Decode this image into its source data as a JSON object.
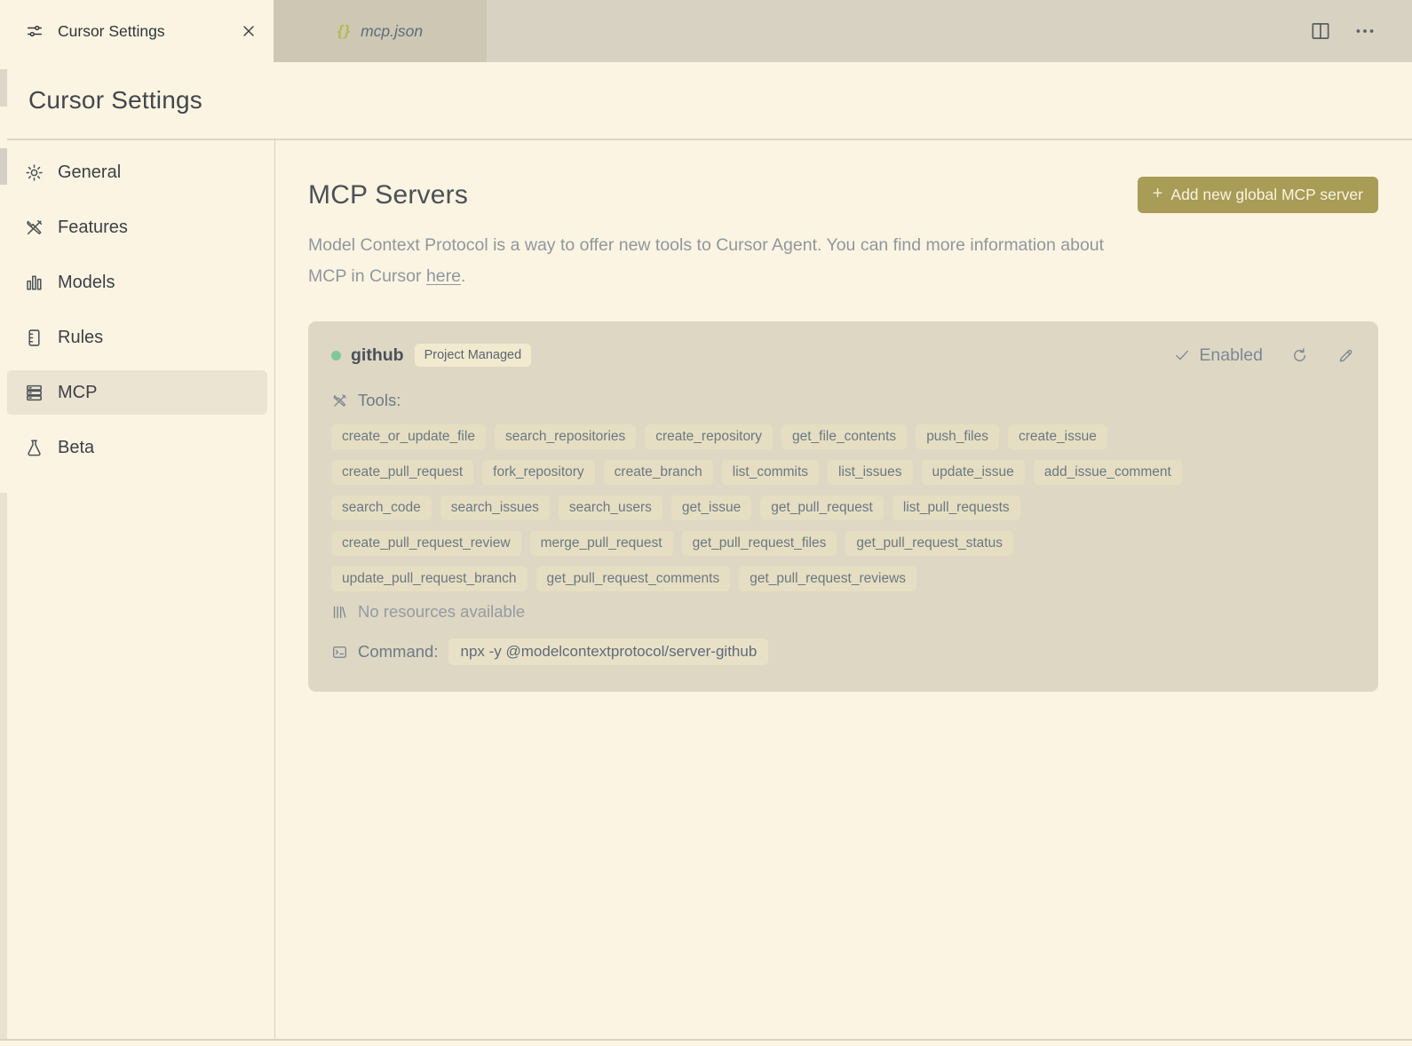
{
  "colors": {
    "page_bg": "#fbf4e2",
    "tab_strip": "#d8d2c2",
    "inactive_tab": "#cec7b4",
    "divider": "#dcd6c6",
    "selected_bg": "#ebe4d3",
    "card_bg": "#ded7c3",
    "tag_bg": "#e6dec2",
    "badge_bg": "#f1eacf",
    "chip_bg": "#e8e1c8",
    "accent": "#a89c56",
    "button_text": "#faf4e1",
    "text_grey": "#90979e",
    "status": "#7b8994",
    "dot": "#80c79a"
  },
  "window": {
    "tabs": [
      {
        "label": "Cursor Settings",
        "icon": "sliders",
        "active": true
      },
      {
        "label": "mcp.json",
        "icon": "braces",
        "icon_glyph": "{}",
        "active": false
      }
    ],
    "actions": [
      {
        "icon": "split-editor"
      },
      {
        "icon": "more"
      }
    ]
  },
  "header": {
    "title": "Cursor Settings"
  },
  "sidebar": {
    "items": [
      {
        "label": "General",
        "icon": "gear"
      },
      {
        "label": "Features",
        "icon": "tools"
      },
      {
        "label": "Models",
        "icon": "bar-chart"
      },
      {
        "label": "Rules",
        "icon": "rules"
      },
      {
        "label": "MCP",
        "icon": "server",
        "selected": true
      },
      {
        "label": "Beta",
        "icon": "flask"
      }
    ]
  },
  "main": {
    "title": "MCP Servers",
    "add_button": {
      "plus": "+",
      "label": "Add new global MCP server"
    },
    "description": {
      "line1": "Model Context Protocol is a way to offer new tools to Cursor Agent. You can find more information about",
      "line2": "MCP in Cursor",
      "link": "here",
      "suffix": "."
    },
    "server_card": {
      "name": "github",
      "badge": "Project Managed",
      "status": "Enabled",
      "tools_label": "Tools:",
      "tools_rows": [
        [
          "create_or_update_file",
          "search_repositories",
          "create_repository",
          "get_file_contents",
          "push_files",
          "create_issue"
        ],
        [
          "create_pull_request",
          "fork_repository",
          "create_branch",
          "list_commits",
          "list_issues",
          "update_issue",
          "add_issue_comment"
        ],
        [
          "search_code",
          "search_issues",
          "search_users",
          "get_issue",
          "get_pull_request",
          "list_pull_requests"
        ],
        [
          "create_pull_request_review",
          "merge_pull_request",
          "get_pull_request_files",
          "get_pull_request_status"
        ],
        [
          "update_pull_request_branch",
          "get_pull_request_comments",
          "get_pull_request_reviews"
        ]
      ],
      "resources_text": "No resources available",
      "command_label": "Command:",
      "command": "npx -y @modelcontextprotocol/server-github"
    }
  }
}
